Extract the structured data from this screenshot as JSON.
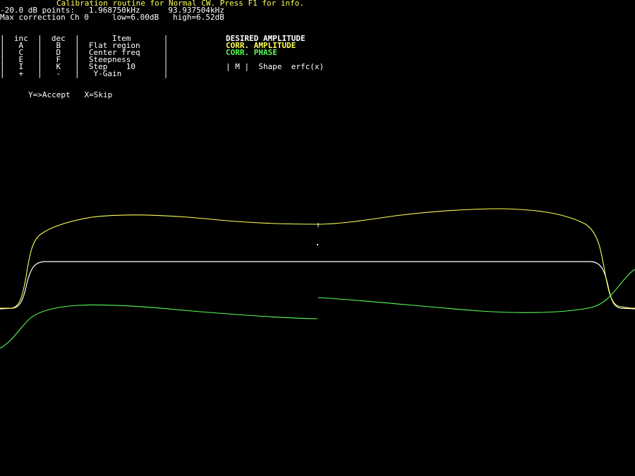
{
  "header": {
    "title": "Calibration routine for Normal CW. Press F1 for info.",
    "points_line": "-20.0 dB points:   1.968750kHz      93.937504kHz",
    "correction_line": "Max correction Ch 0     low=6.00dB   high=6.52dB"
  },
  "key_table": {
    "rows": [
      "|  inc  |  dec  |       Item       |",
      "|   A   |   B   |  Flat region     |",
      "|   C   |   D   |  Center freq     |",
      "|   E   |   F   |  Steepness       |",
      "|   I   |   K   |  Step    10      |",
      "|   +   |   -   |   Y-Gain         |"
    ]
  },
  "legend": {
    "desired": "DESIRED AMPLITUDE",
    "corr_amplitude": "CORR. AMPLITUDE",
    "corr_phase": "CORR. PHASE",
    "shape_line": "| M |  Shape  erfc(x)"
  },
  "prompt": "Y=>Accept   X=Skip",
  "colors": {
    "background": "#000000",
    "desired": "#ffffff",
    "corr_amplitude": "#ffff55",
    "corr_phase": "#55ff55"
  }
}
